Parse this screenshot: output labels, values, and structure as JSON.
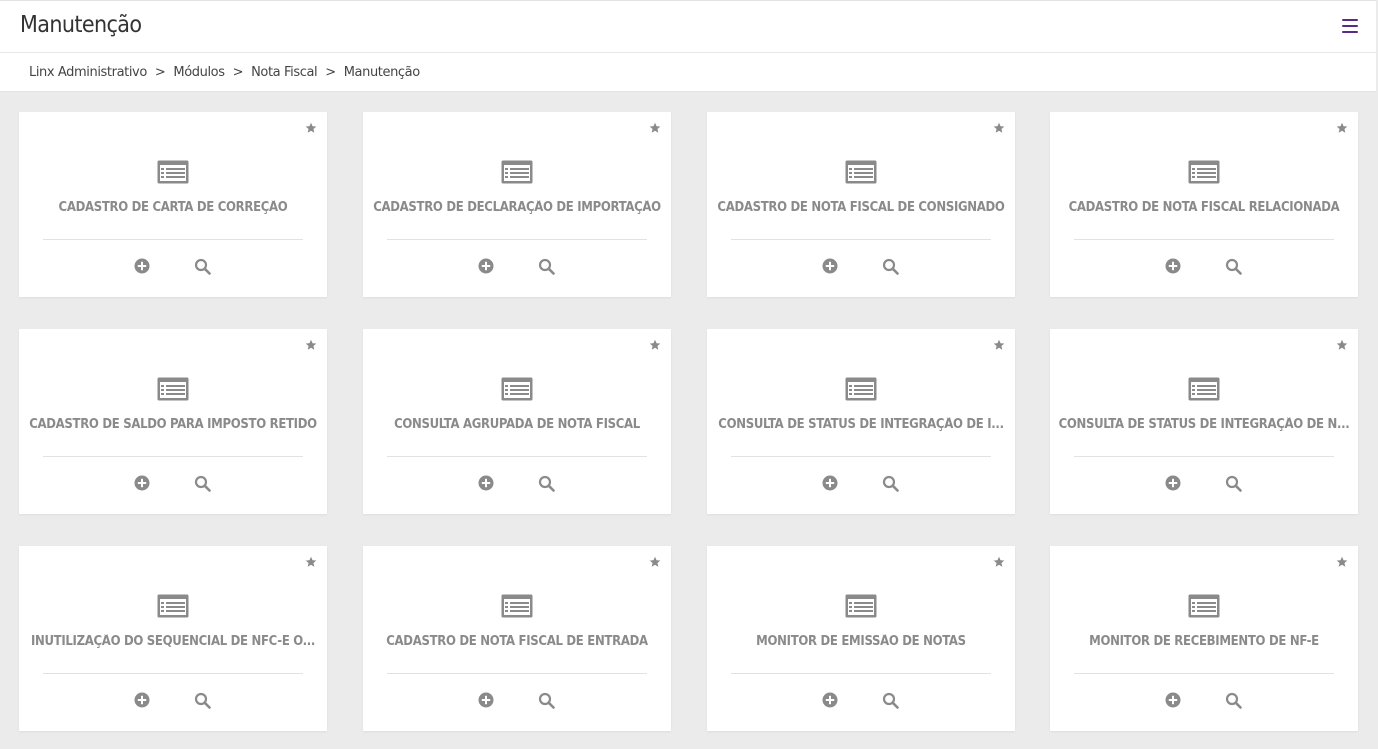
{
  "header": {
    "title": "Manutenção",
    "menu_icon": "hamburger-menu-icon",
    "accent_color": "#5b2a86"
  },
  "breadcrumb": {
    "separator": ">",
    "items": [
      "Linx Administrativo",
      "Módulos",
      "Nota Fiscal",
      "Manutenção"
    ]
  },
  "cards": [
    {
      "title": "CADASTRO DE CARTA DE CORREÇÃO"
    },
    {
      "title": "CADASTRO DE DECLARAÇÃO DE IMPORTAÇÃO"
    },
    {
      "title": "CADASTRO DE NOTA FISCAL DE CONSIGNADO"
    },
    {
      "title": "CADASTRO DE NOTA FISCAL RELACIONADA"
    },
    {
      "title": "CADASTRO DE SALDO PARA IMPOSTO RETIDO"
    },
    {
      "title": "CONSULTA AGRUPADA DE NOTA FISCAL"
    },
    {
      "title": "CONSULTA DE STATUS DE INTEGRAÇÃO DE I..."
    },
    {
      "title": "CONSULTA DE STATUS DE INTEGRAÇÃO DE N..."
    },
    {
      "title": "INUTILIZAÇÃO DO SEQUENCIAL DE NFC-E O..."
    },
    {
      "title": "CADASTRO DE NOTA FISCAL DE ENTRADA"
    },
    {
      "title": "MONITOR DE EMISSÃO DE NOTAS"
    },
    {
      "title": "MONITOR DE RECEBIMENTO DE NF-E"
    }
  ],
  "icons": {
    "favorite": "star-icon",
    "module": "document-list-icon",
    "add": "plus-circle-icon",
    "search": "search-icon"
  },
  "colors": {
    "icon": "#8a8a8a",
    "background": "#ebebeb",
    "card": "#ffffff"
  }
}
